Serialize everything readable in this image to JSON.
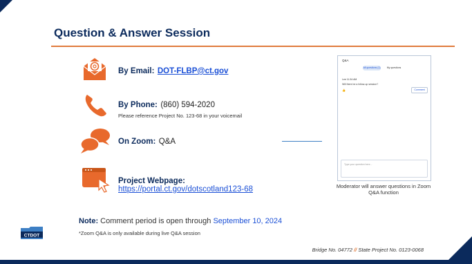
{
  "title": "Question & Answer Session",
  "email": {
    "label": "By Email:",
    "address": "DOT-FLBP@ct.gov"
  },
  "phone": {
    "label": "By Phone:",
    "number": "(860) 594-2020",
    "note": "Please reference Project No. 123-68 in your voicemail"
  },
  "zoom": {
    "label": "On Zoom:",
    "value": "Q&A"
  },
  "webpage": {
    "label": "Project Webpage:",
    "url": "https://portal.ct.gov/dotscotland123-68"
  },
  "zoom_panel": {
    "header": "Q&A",
    "tab_all": "All questions (1)",
    "tab_my": "My questions",
    "user": "Lee  11:34 AM",
    "question": "Will there be a follow-up session?",
    "comment_button": "Comment",
    "input_placeholder": "Type your question here..."
  },
  "caption": "Moderator will answer questions in Zoom Q&A function",
  "note": {
    "label": "Note:",
    "text": "Comment period is open through",
    "date": "September 10, 2024"
  },
  "footnote": "*Zoom Q&A is only available during live Q&A session",
  "bridge": {
    "bridge_no": "Bridge No. 04772",
    "separator": "//",
    "project_no": "State Project No. 0123-0068"
  },
  "logo_text": "CTDOT",
  "colors": {
    "navy": "#0b2a5c",
    "orange": "#e07a3b",
    "link_blue": "#1a4fd6"
  },
  "icons": [
    "email-icon",
    "phone-icon",
    "chat-icon",
    "webpage-icon"
  ]
}
